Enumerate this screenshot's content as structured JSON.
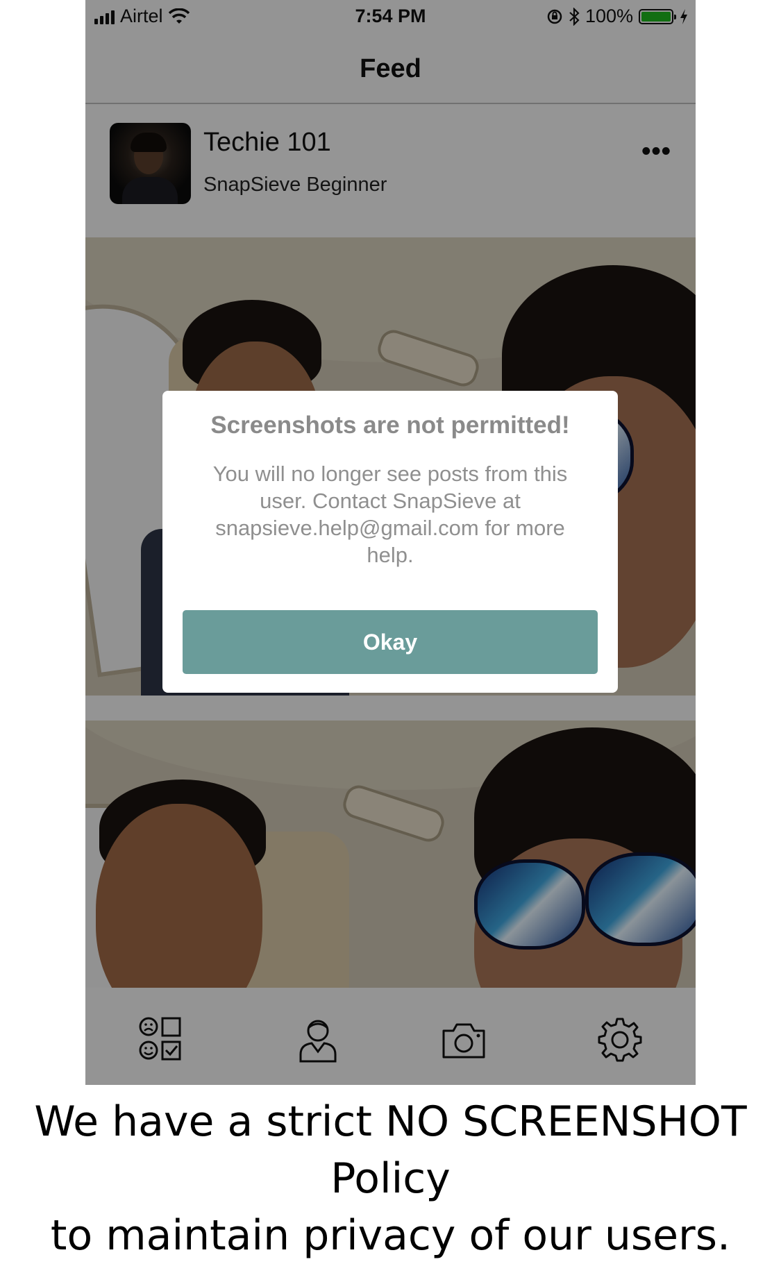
{
  "status_bar": {
    "carrier": "Airtel",
    "time": "7:54 PM",
    "battery_text": "100%",
    "icons": [
      "signal-icon",
      "wifi-icon",
      "rotation-lock-icon",
      "bluetooth-icon",
      "battery-icon",
      "charging-icon"
    ]
  },
  "navbar": {
    "title": "Feed"
  },
  "post": {
    "username": "Techie 101",
    "level": "SnapSieve Beginner",
    "more_icon": "more-icon"
  },
  "dialog": {
    "title": "Screenshots are not permitted!",
    "message": "You will no longer see posts from this user. Contact SnapSieve at snapsieve.help@gmail.com for more help.",
    "button_label": "Okay",
    "button_color": "#6a9c9a"
  },
  "tabbar": {
    "tabs": [
      "rate-icon",
      "profile-icon",
      "camera-icon",
      "settings-icon"
    ]
  },
  "caption": {
    "line1": "We have a strict NO SCREENSHOT Policy",
    "line2": "to maintain privacy of our users."
  }
}
